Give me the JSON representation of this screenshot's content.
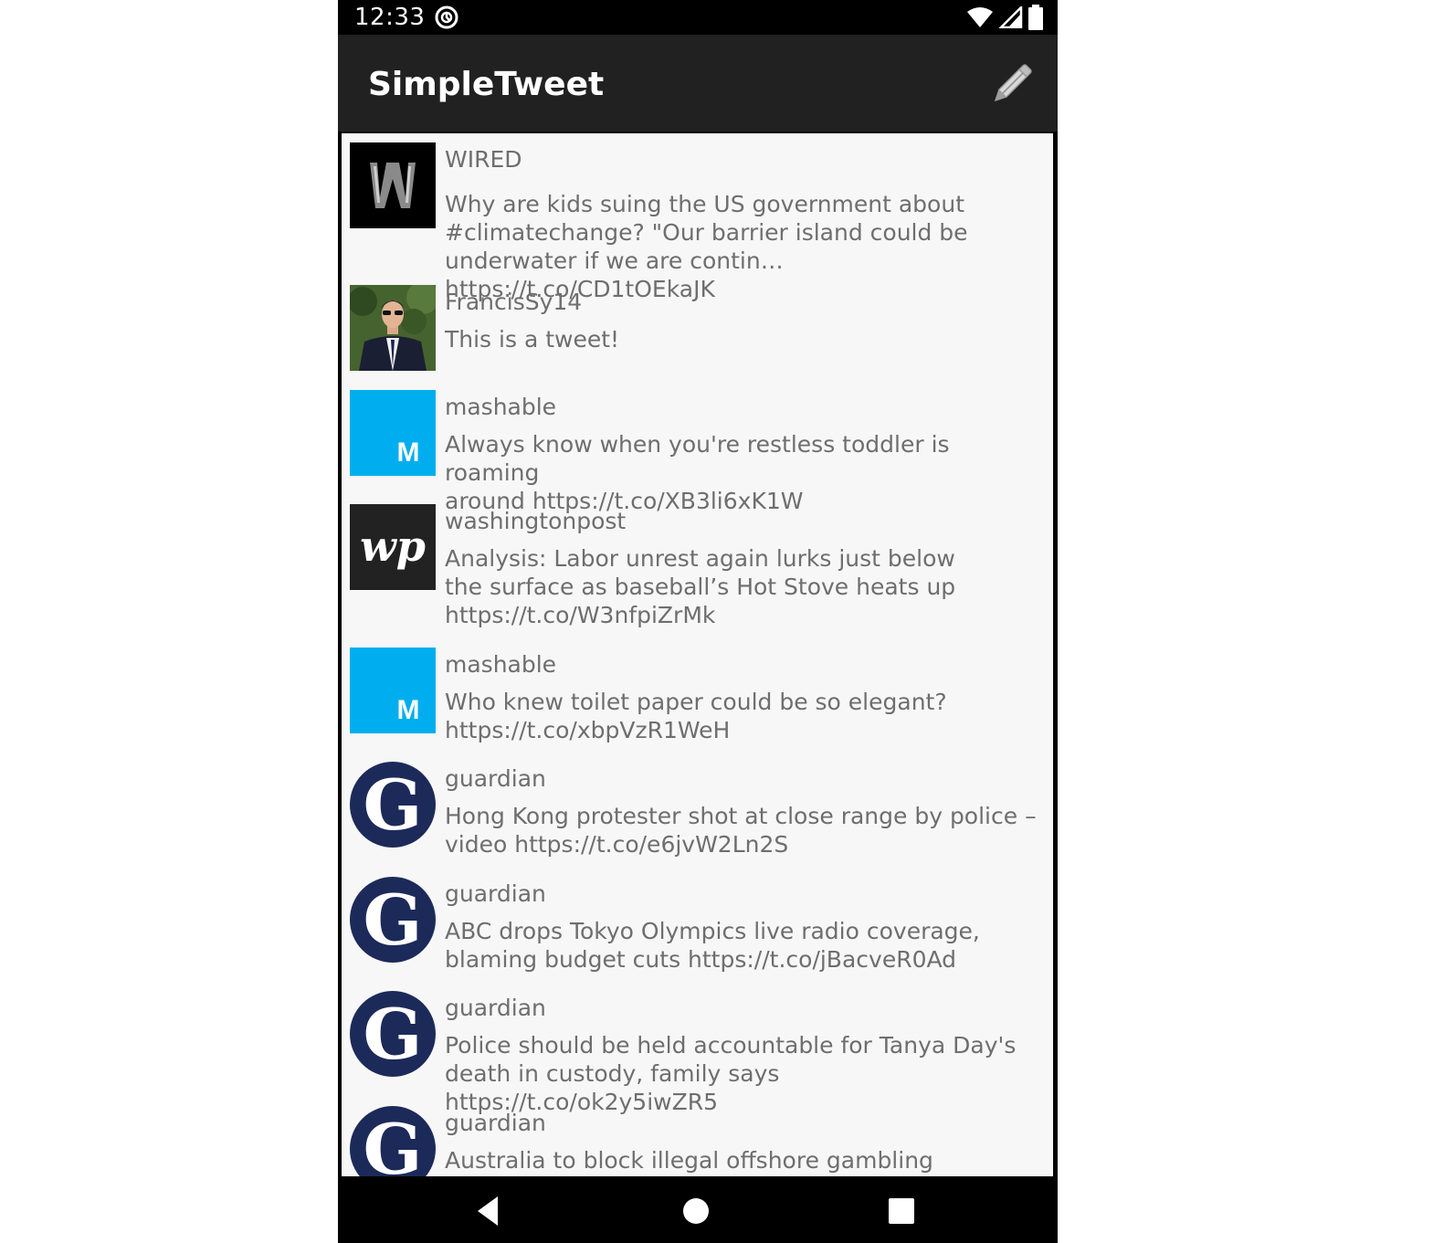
{
  "status_bar": {
    "time": "12:33",
    "icons": [
      "sync-icon",
      "wifi-icon",
      "signal-icon",
      "battery-icon"
    ]
  },
  "app_bar": {
    "title": "SimpleTweet",
    "compose_icon": "pencil-icon"
  },
  "colors": {
    "app_bar": "#212121",
    "list_bg": "#f7f7f7",
    "text": "#6e6e6e",
    "mashable_blue": "#00aeef",
    "guardian_navy": "#1c2a5a"
  },
  "tweets": [
    {
      "avatar": "wired-logo",
      "handle": "WIRED",
      "text": "Why are kids suing the US government about\n#climatechange? \"Our barrier island could be\nunderwater if we are contin… https://t.co/CD1tOEkaJK"
    },
    {
      "avatar": "user-photo",
      "handle": "FrancisSy14",
      "text": "This is a tweet!"
    },
    {
      "avatar": "mashable-logo",
      "handle": "mashable",
      "text": "Always know when you're restless toddler is roaming\naround https://t.co/XB3li6xK1W"
    },
    {
      "avatar": "washingtonpost-logo",
      "handle": "washingtonpost",
      "text": "Analysis: Labor unrest again lurks just below\nthe surface as baseball’s Hot Stove heats up\nhttps://t.co/W3nfpiZrMk"
    },
    {
      "avatar": "mashable-logo",
      "handle": "mashable",
      "text": "Who knew toilet paper could be so elegant?\nhttps://t.co/xbpVzR1WeH"
    },
    {
      "avatar": "guardian-logo",
      "handle": "guardian",
      "text": "Hong Kong protester shot at close range by police –\nvideo https://t.co/e6jvW2Ln2S"
    },
    {
      "avatar": "guardian-logo",
      "handle": "guardian",
      "text": "ABC drops Tokyo Olympics live radio coverage,\nblaming budget cuts https://t.co/jBacveR0Ad"
    },
    {
      "avatar": "guardian-logo",
      "handle": "guardian",
      "text": "Police should be held accountable for Tanya Day's\ndeath in custody, family says https://t.co/ok2y5iwZR5"
    },
    {
      "avatar": "guardian-logo",
      "handle": "guardian",
      "text": "Australia to block illegal offshore gambling websites"
    }
  ],
  "nav_bar": {
    "back_icon": "back-icon",
    "home_icon": "home-icon",
    "recents_icon": "recents-icon"
  }
}
